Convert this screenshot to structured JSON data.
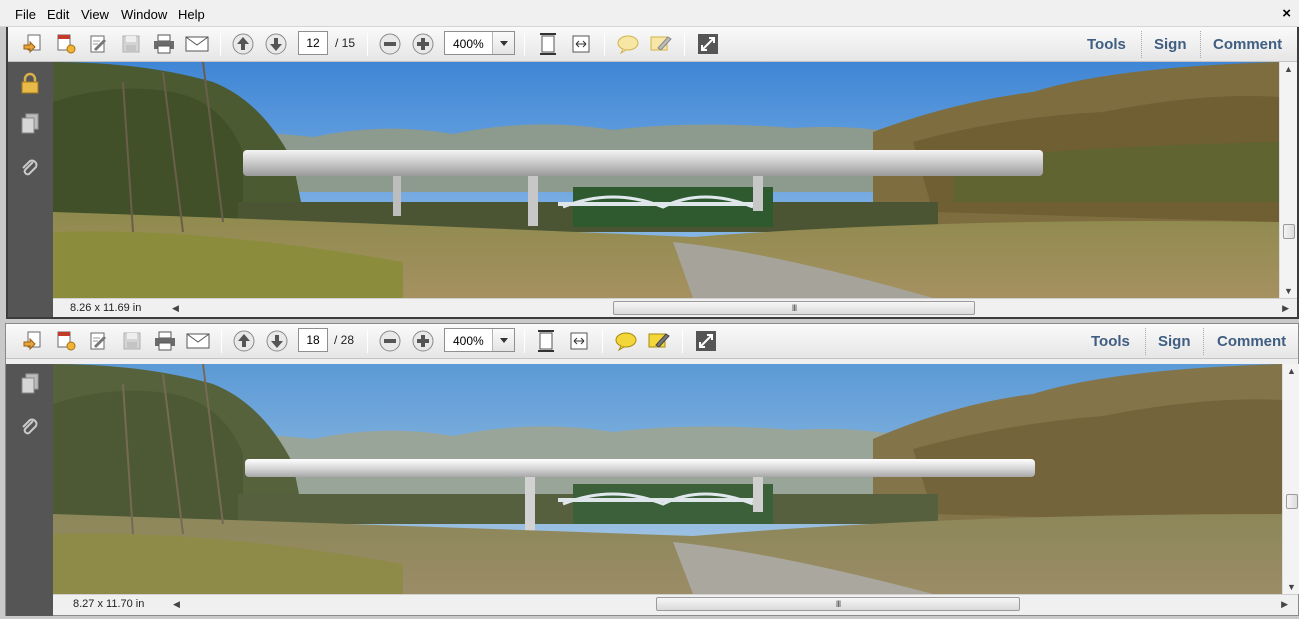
{
  "menu": {
    "items": [
      "File",
      "Edit",
      "View",
      "Window",
      "Help"
    ],
    "close": "×"
  },
  "windows": [
    {
      "page_current": "12",
      "page_total": "/ 15",
      "zoom": "400%",
      "links": {
        "tools": "Tools",
        "sign": "Sign",
        "comment": "Comment"
      },
      "page_size": "8.26 x 11.69 in",
      "scroll_grip": "III"
    },
    {
      "page_current": "18",
      "page_total": "/ 28",
      "zoom": "400%",
      "links": {
        "tools": "Tools",
        "sign": "Sign",
        "comment": "Comment"
      },
      "page_size": "8.27 x 11.70 in",
      "scroll_grip": "III"
    }
  ],
  "icons": {
    "toolbar": [
      "create-pdf-icon",
      "export-pdf-icon",
      "edit-pdf-icon",
      "save-icon",
      "print-icon",
      "email-icon",
      "page-up-icon",
      "page-down-icon",
      "zoom-out-icon",
      "zoom-in-icon",
      "fit-page-icon",
      "fit-width-icon",
      "sticky-note-icon",
      "highlight-icon",
      "fullscreen-icon"
    ],
    "side_panel": [
      "lock-icon",
      "pages-icon",
      "attachment-icon"
    ]
  },
  "colors": {
    "link": "#3f5e82",
    "side_panel": "#555555",
    "sky": "#5b9ad6"
  }
}
